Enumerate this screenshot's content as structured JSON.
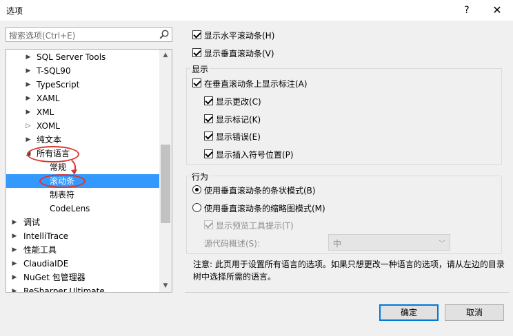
{
  "window": {
    "title": "选项",
    "help_label": "?",
    "close_label": "✕"
  },
  "search": {
    "placeholder": "搜索选项(Ctrl+E)",
    "icon": "search-icon"
  },
  "tree": {
    "items": [
      {
        "label": "SQL Server Tools",
        "arrow": "▶"
      },
      {
        "label": "T-SQL90",
        "arrow": "▶"
      },
      {
        "label": "TypeScript",
        "arrow": "▶"
      },
      {
        "label": "XAML",
        "arrow": "▶"
      },
      {
        "label": "XML",
        "arrow": "▶"
      },
      {
        "label": "XOML",
        "arrow": "▷"
      },
      {
        "label": "纯文本",
        "arrow": "▶"
      },
      {
        "label": "所有语言",
        "arrow": "◢"
      },
      {
        "label": "常规",
        "arrow": ""
      },
      {
        "label": "滚动条",
        "arrow": "",
        "selected": true
      },
      {
        "label": "制表符",
        "arrow": ""
      },
      {
        "label": "CodeLens",
        "arrow": ""
      },
      {
        "label": "调试",
        "arrow": "▶"
      },
      {
        "label": "IntelliTrace",
        "arrow": "▶"
      },
      {
        "label": "性能工具",
        "arrow": "▶"
      },
      {
        "label": "ClaudiaIDE",
        "arrow": "▶"
      },
      {
        "label": "NuGet 包管理器",
        "arrow": "▶"
      },
      {
        "label": "ReSharper Ultimate",
        "arrow": "▶"
      }
    ],
    "scroll_up": "▲",
    "scroll_down": "▼"
  },
  "options": {
    "show_horizontal": {
      "label": "显示水平滚动条(H)",
      "checked": true
    },
    "show_vertical": {
      "label": "显示垂直滚动条(V)",
      "checked": true
    },
    "display_group": {
      "title": "显示",
      "show_annotations": {
        "label": "在垂直滚动条上显示标注(A)",
        "checked": true
      },
      "show_changes": {
        "label": "显示更改(C)",
        "checked": true
      },
      "show_marks": {
        "label": "显示标记(K)",
        "checked": true
      },
      "show_errors": {
        "label": "显示错误(E)",
        "checked": true
      },
      "show_caret": {
        "label": "显示插入符号位置(P)",
        "checked": true
      }
    },
    "behavior_group": {
      "title": "行为",
      "bar_mode": {
        "label": "使用垂直滚动条的条状模式(B)",
        "checked": true
      },
      "map_mode": {
        "label": "使用垂直滚动条的缩略图模式(M)",
        "checked": false
      },
      "show_preview": {
        "label": "显示预览工具提示(T)",
        "checked": true,
        "disabled": true
      },
      "source_overview_label": "源代码概述(S):",
      "source_overview_value": "中"
    }
  },
  "note": "注意: 此页用于设置所有语言的选项。如果只想更改一种语言的选项，请从左边的目录树中选择所需的语言。",
  "buttons": {
    "ok": "确定",
    "cancel": "取消"
  },
  "colors": {
    "selection": "#3399ff",
    "annotation": "#d9352f",
    "primary_border": "#0078d7"
  }
}
